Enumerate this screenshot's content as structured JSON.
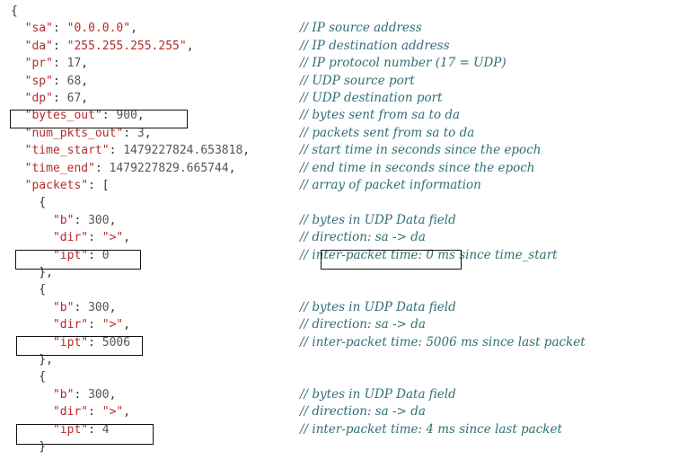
{
  "lines": [
    {
      "code": [
        {
          "t": "{",
          "c": "pun"
        }
      ],
      "comment": ""
    },
    {
      "code": [
        {
          "t": "  ",
          "c": "pun"
        },
        {
          "t": "\"sa\"",
          "c": "key"
        },
        {
          "t": ": ",
          "c": "pun"
        },
        {
          "t": "\"0.0.0.0\"",
          "c": "str"
        },
        {
          "t": ",",
          "c": "pun"
        }
      ],
      "comment": "// IP source address"
    },
    {
      "code": [
        {
          "t": "  ",
          "c": "pun"
        },
        {
          "t": "\"da\"",
          "c": "key"
        },
        {
          "t": ": ",
          "c": "pun"
        },
        {
          "t": "\"255.255.255.255\"",
          "c": "str"
        },
        {
          "t": ",",
          "c": "pun"
        }
      ],
      "comment": "// IP destination address"
    },
    {
      "code": [
        {
          "t": "  ",
          "c": "pun"
        },
        {
          "t": "\"pr\"",
          "c": "key"
        },
        {
          "t": ": ",
          "c": "pun"
        },
        {
          "t": "17",
          "c": "num"
        },
        {
          "t": ",",
          "c": "pun"
        }
      ],
      "comment": "// IP protocol number (17 = UDP)"
    },
    {
      "code": [
        {
          "t": "  ",
          "c": "pun"
        },
        {
          "t": "\"sp\"",
          "c": "key"
        },
        {
          "t": ": ",
          "c": "pun"
        },
        {
          "t": "68",
          "c": "num"
        },
        {
          "t": ",",
          "c": "pun"
        }
      ],
      "comment": "// UDP source port"
    },
    {
      "code": [
        {
          "t": "  ",
          "c": "pun"
        },
        {
          "t": "\"dp\"",
          "c": "key"
        },
        {
          "t": ": ",
          "c": "pun"
        },
        {
          "t": "67",
          "c": "num"
        },
        {
          "t": ",",
          "c": "pun"
        }
      ],
      "comment": "// UDP destination port"
    },
    {
      "code": [
        {
          "t": "  ",
          "c": "pun"
        },
        {
          "t": "\"bytes_out\"",
          "c": "key"
        },
        {
          "t": ": ",
          "c": "pun"
        },
        {
          "t": "900",
          "c": "num"
        },
        {
          "t": ",",
          "c": "pun"
        }
      ],
      "comment": "// bytes sent from sa to da"
    },
    {
      "code": [
        {
          "t": "  ",
          "c": "pun"
        },
        {
          "t": "\"num_pkts_out\"",
          "c": "key"
        },
        {
          "t": ": ",
          "c": "pun"
        },
        {
          "t": "3",
          "c": "num"
        },
        {
          "t": ",",
          "c": "pun"
        }
      ],
      "comment": "// packets sent from sa to da"
    },
    {
      "code": [
        {
          "t": "  ",
          "c": "pun"
        },
        {
          "t": "\"time_start\"",
          "c": "key"
        },
        {
          "t": ": ",
          "c": "pun"
        },
        {
          "t": "1479227824.653818",
          "c": "num"
        },
        {
          "t": ",",
          "c": "pun"
        }
      ],
      "comment": "// start time in seconds since the epoch"
    },
    {
      "code": [
        {
          "t": "  ",
          "c": "pun"
        },
        {
          "t": "\"time_end\"",
          "c": "key"
        },
        {
          "t": ": ",
          "c": "pun"
        },
        {
          "t": "1479227829.665744",
          "c": "num"
        },
        {
          "t": ",",
          "c": "pun"
        }
      ],
      "comment": "// end time in seconds since the epoch"
    },
    {
      "code": [
        {
          "t": "  ",
          "c": "pun"
        },
        {
          "t": "\"packets\"",
          "c": "key"
        },
        {
          "t": ": [",
          "c": "pun"
        }
      ],
      "comment": "// array of packet information"
    },
    {
      "code": [
        {
          "t": "    {",
          "c": "pun"
        }
      ],
      "comment": ""
    },
    {
      "code": [
        {
          "t": "      ",
          "c": "pun"
        },
        {
          "t": "\"b\"",
          "c": "key"
        },
        {
          "t": ": ",
          "c": "pun"
        },
        {
          "t": "300",
          "c": "num"
        },
        {
          "t": ",",
          "c": "pun"
        }
      ],
      "comment": "// bytes in UDP Data field"
    },
    {
      "code": [
        {
          "t": "      ",
          "c": "pun"
        },
        {
          "t": "\"dir\"",
          "c": "key"
        },
        {
          "t": ": ",
          "c": "pun"
        },
        {
          "t": "\">\"",
          "c": "str"
        },
        {
          "t": ",",
          "c": "pun"
        }
      ],
      "comment": "// direction: sa -> da"
    },
    {
      "code": [
        {
          "t": "      ",
          "c": "pun"
        },
        {
          "t": "\"ipt\"",
          "c": "key"
        },
        {
          "t": ": ",
          "c": "pun"
        },
        {
          "t": "0",
          "c": "num"
        }
      ],
      "comment": "// inter-packet time: 0 ms since time_start"
    },
    {
      "code": [
        {
          "t": "    },",
          "c": "pun"
        }
      ],
      "comment": ""
    },
    {
      "code": [
        {
          "t": "    {",
          "c": "pun"
        }
      ],
      "comment": ""
    },
    {
      "code": [
        {
          "t": "      ",
          "c": "pun"
        },
        {
          "t": "\"b\"",
          "c": "key"
        },
        {
          "t": ": ",
          "c": "pun"
        },
        {
          "t": "300",
          "c": "num"
        },
        {
          "t": ",",
          "c": "pun"
        }
      ],
      "comment": "// bytes in UDP Data field"
    },
    {
      "code": [
        {
          "t": "      ",
          "c": "pun"
        },
        {
          "t": "\"dir\"",
          "c": "key"
        },
        {
          "t": ": ",
          "c": "pun"
        },
        {
          "t": "\">\"",
          "c": "str"
        },
        {
          "t": ",",
          "c": "pun"
        }
      ],
      "comment": "// direction: sa -> da"
    },
    {
      "code": [
        {
          "t": "      ",
          "c": "pun"
        },
        {
          "t": "\"ipt\"",
          "c": "key"
        },
        {
          "t": ": ",
          "c": "pun"
        },
        {
          "t": "5006",
          "c": "num"
        }
      ],
      "comment": "// inter-packet time: 5006 ms since last packet"
    },
    {
      "code": [
        {
          "t": "    },",
          "c": "pun"
        }
      ],
      "comment": ""
    },
    {
      "code": [
        {
          "t": "    {",
          "c": "pun"
        }
      ],
      "comment": ""
    },
    {
      "code": [
        {
          "t": "      ",
          "c": "pun"
        },
        {
          "t": "\"b\"",
          "c": "key"
        },
        {
          "t": ": ",
          "c": "pun"
        },
        {
          "t": "300",
          "c": "num"
        },
        {
          "t": ",",
          "c": "pun"
        }
      ],
      "comment": "// bytes in UDP Data field"
    },
    {
      "code": [
        {
          "t": "      ",
          "c": "pun"
        },
        {
          "t": "\"dir\"",
          "c": "key"
        },
        {
          "t": ": ",
          "c": "pun"
        },
        {
          "t": "\">\"",
          "c": "str"
        },
        {
          "t": ",",
          "c": "pun"
        }
      ],
      "comment": "// direction: sa -> da"
    },
    {
      "code": [
        {
          "t": "      ",
          "c": "pun"
        },
        {
          "t": "\"ipt\"",
          "c": "key"
        },
        {
          "t": ": ",
          "c": "pun"
        },
        {
          "t": "4",
          "c": "num"
        }
      ],
      "comment": "// inter-packet time: 4 ms since last packet"
    },
    {
      "code": [
        {
          "t": "    }",
          "c": "pun"
        }
      ],
      "comment": ""
    }
  ],
  "colors": {
    "key": "#b52a2a",
    "number": "#555555",
    "comment": "#2f6f73",
    "box": "#111111"
  }
}
